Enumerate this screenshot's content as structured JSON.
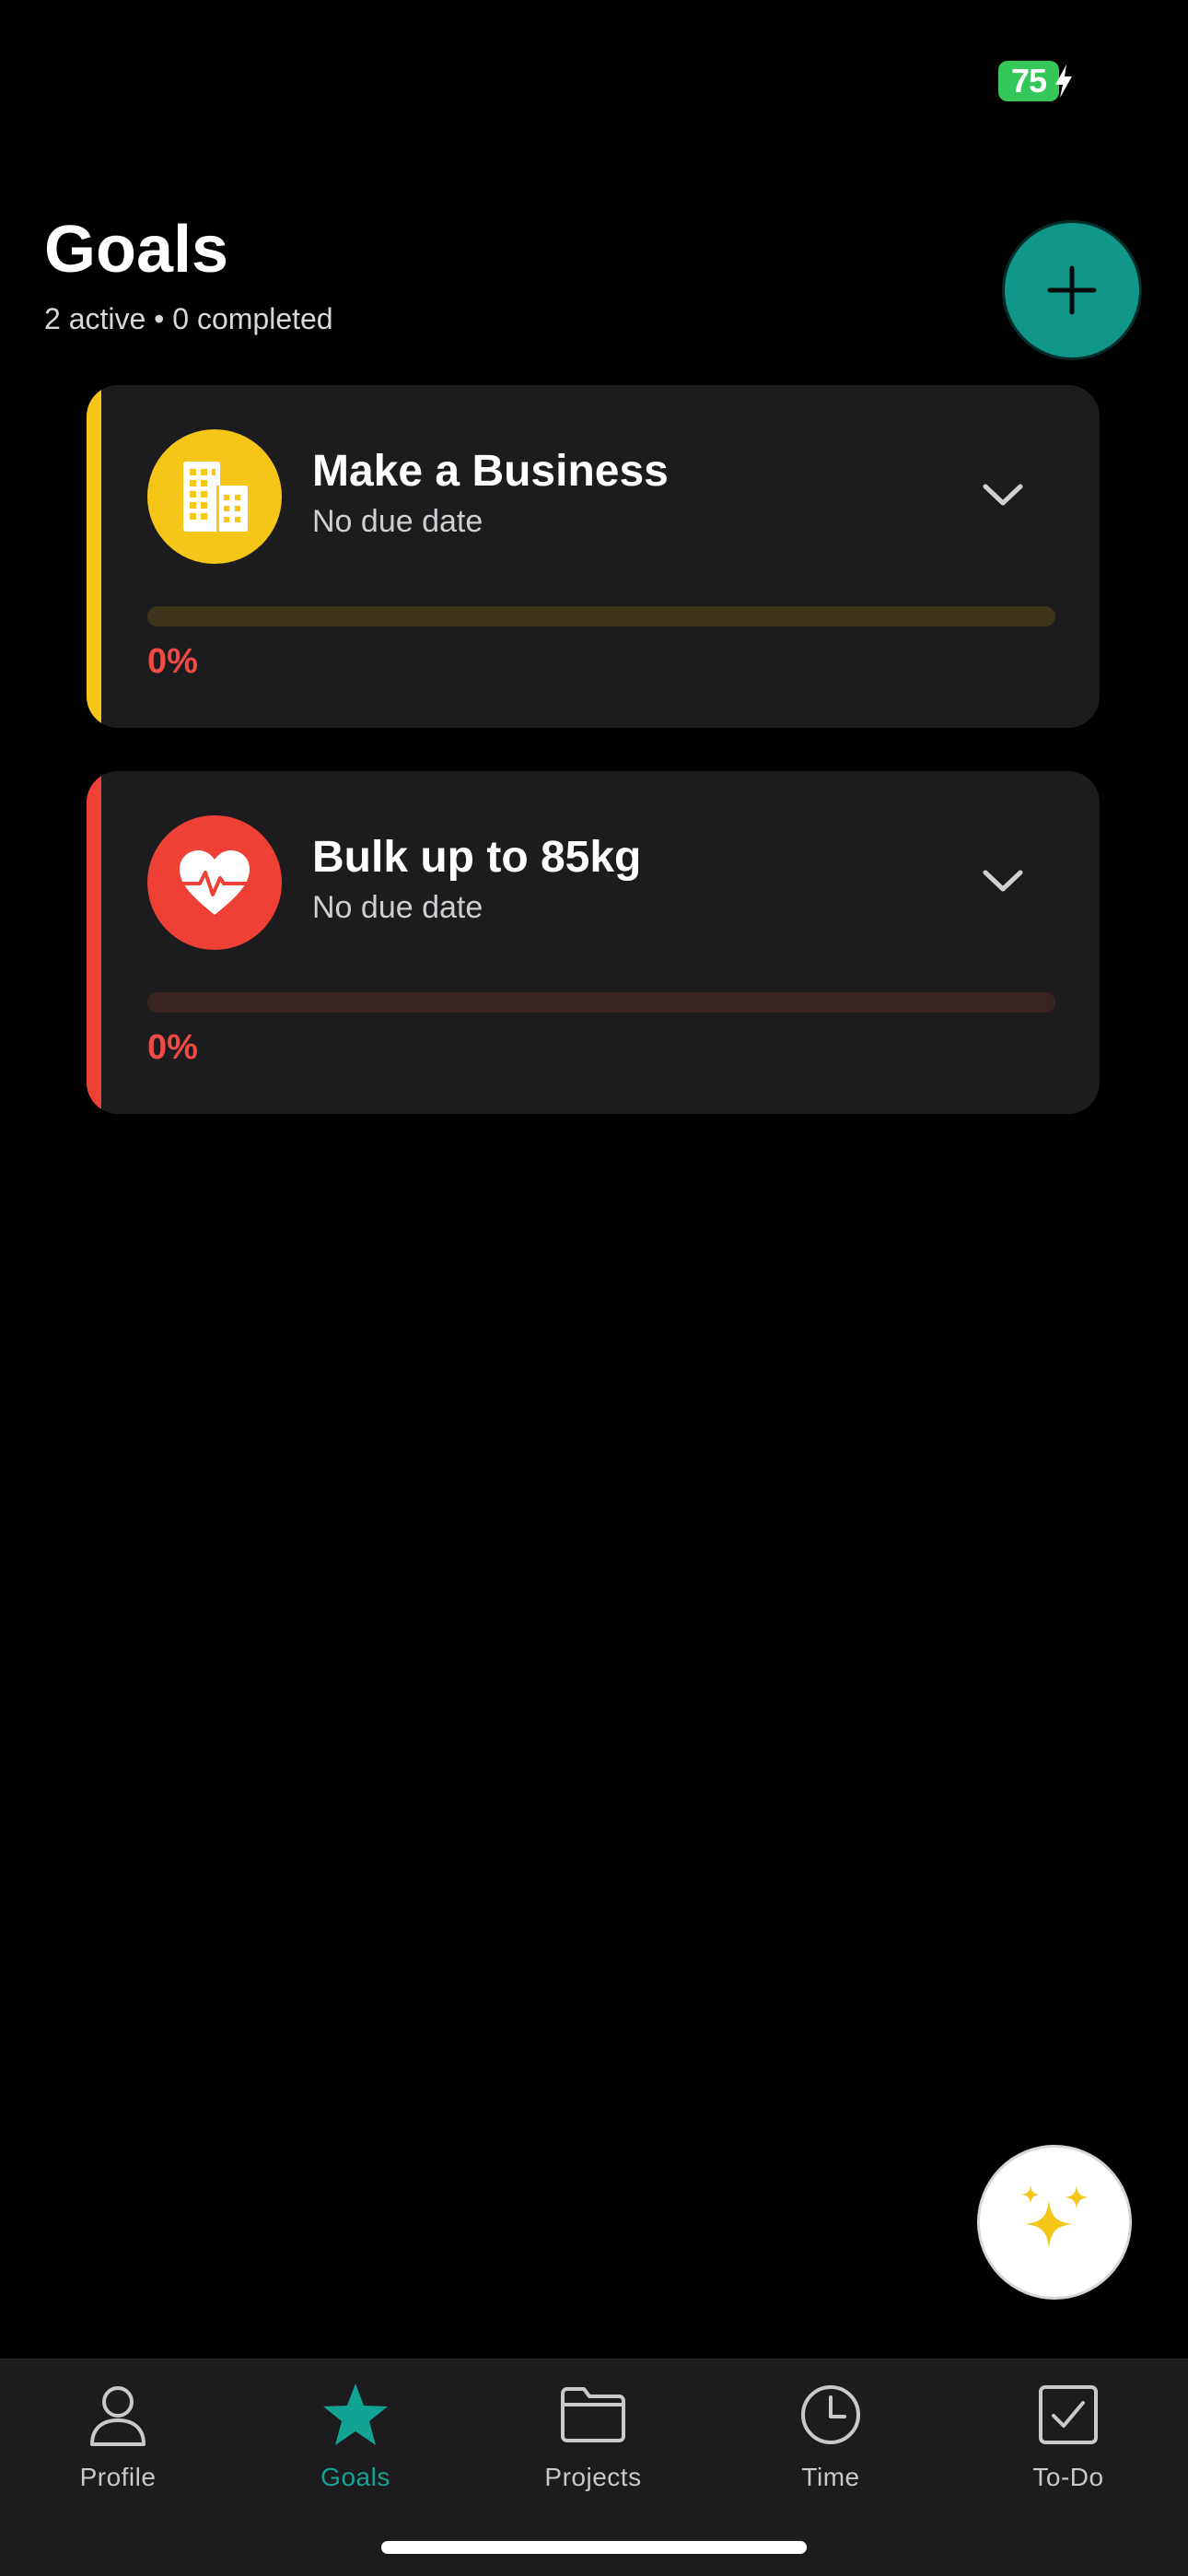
{
  "status_bar": {
    "battery_level": "75",
    "battery_color": "#34c759"
  },
  "header": {
    "title": "Goals",
    "subtitle": "2 active • 0 completed",
    "add_button_icon": "plus-icon",
    "add_button_color": "#11968a"
  },
  "goals": [
    {
      "title": "Make a Business",
      "due": "No due date",
      "progress_label": "0%",
      "progress": 0,
      "icon": "building-icon",
      "color": "#f5c518",
      "track_color": "#3d351a"
    },
    {
      "title": "Bulk up to 85kg",
      "due": "No due date",
      "progress_label": "0%",
      "progress": 0,
      "icon": "heart-pulse-icon",
      "color": "#ee4035",
      "track_color": "#3a2422"
    }
  ],
  "sparkle_button": {
    "icon": "sparkles-icon",
    "color": "#f5c518"
  },
  "tabs": [
    {
      "label": "Profile",
      "icon": "person-icon",
      "active": false
    },
    {
      "label": "Goals",
      "icon": "star-icon",
      "active": true
    },
    {
      "label": "Projects",
      "icon": "folder-icon",
      "active": false
    },
    {
      "label": "Time",
      "icon": "clock-icon",
      "active": false
    },
    {
      "label": "To-Do",
      "icon": "checkbox-icon",
      "active": false
    }
  ],
  "colors": {
    "background": "#000000",
    "card": "#1c1c1e",
    "accent": "#12a394",
    "progress_text": "#ef4b45"
  }
}
